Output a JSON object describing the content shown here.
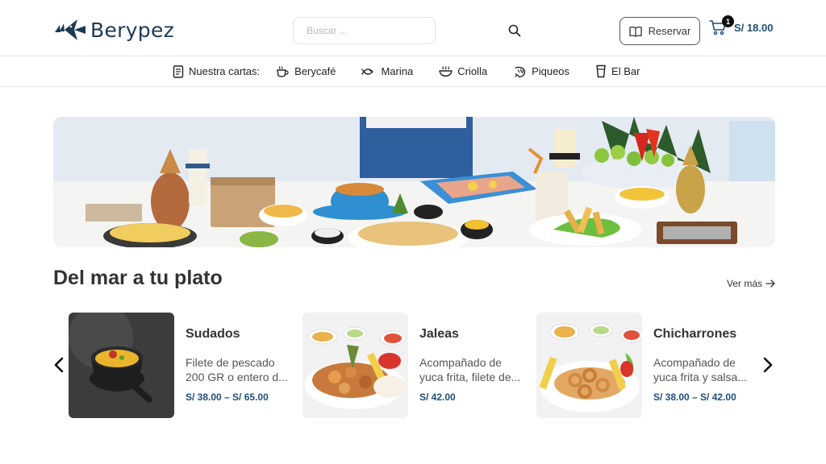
{
  "brand": {
    "name": "Berypez"
  },
  "search": {
    "placeholder": "Buscar ..."
  },
  "header": {
    "reserve_label": "Reservar",
    "cart_count": "1",
    "cart_total": "S/ 18.00"
  },
  "nav": {
    "label": "Nuestra cartas:",
    "items": [
      {
        "label": "Berycafé",
        "icon": "coffee-cup-icon"
      },
      {
        "label": "Marina",
        "icon": "fish-icon"
      },
      {
        "label": "Criolla",
        "icon": "bowl-icon"
      },
      {
        "label": "Piqueos",
        "icon": "shrimp-icon"
      },
      {
        "label": "El Bar",
        "icon": "glass-icon"
      }
    ]
  },
  "section": {
    "title": "Del mar a tu plato",
    "see_more": "Ver más"
  },
  "products": [
    {
      "name": "Sudados",
      "desc_line1": "Filete de pescado",
      "desc_line2": "200 GR o entero d...",
      "price": "S/ 38.00 – S/ 65.00"
    },
    {
      "name": "Jaleas",
      "desc_line1": "Acompañado de",
      "desc_line2": "yuca frita, filete de...",
      "price": "S/ 42.00"
    },
    {
      "name": "Chicharrones",
      "desc_line1": "Acompañado de",
      "desc_line2": "yuca frita y salsa...",
      "price": "S/ 38.00 – S/ 42.00"
    }
  ],
  "colors": {
    "brand": "#1d3a55",
    "price": "#1f4e79"
  }
}
